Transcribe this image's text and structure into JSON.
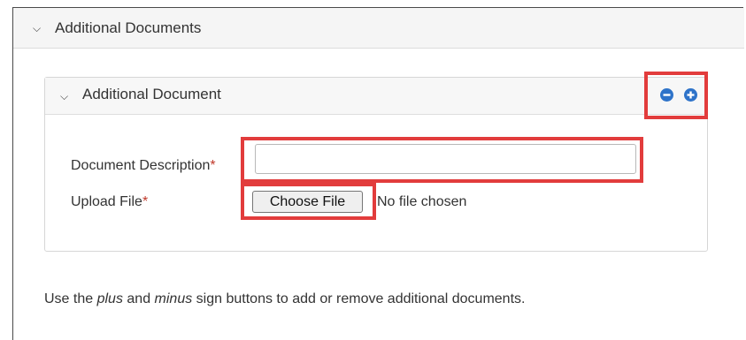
{
  "outer_section": {
    "title": "Additional Documents",
    "chevron_icon": "chevron-down-icon"
  },
  "document_panel": {
    "title": "Additional Document",
    "chevron_icon": "chevron-down-icon",
    "actions": {
      "remove_icon": "minus-circle-icon",
      "add_icon": "plus-circle-icon",
      "icon_color": "#2e73c9"
    }
  },
  "form": {
    "description": {
      "label": "Document Description",
      "required_mark": "*",
      "value": ""
    },
    "upload": {
      "label": "Upload File",
      "required_mark": "*",
      "button_label": "Choose File",
      "status": "No file chosen"
    }
  },
  "help": {
    "prefix": "Use the ",
    "plus_word": "plus",
    "connector": " and ",
    "minus_word": "minus",
    "suffix": " sign buttons to add or remove additional documents."
  },
  "theme": {
    "highlight_color": "#e23c3c",
    "required_color": "#c0392b"
  }
}
